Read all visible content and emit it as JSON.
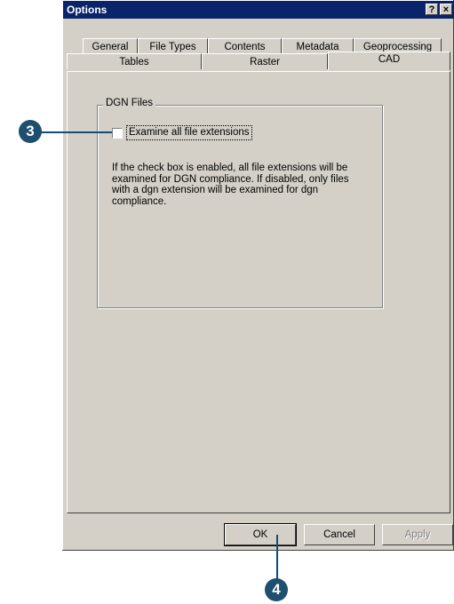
{
  "window": {
    "title": "Options",
    "help_button": "?",
    "close_button": "×"
  },
  "tabs": {
    "row1": [
      "General",
      "File Types",
      "Contents",
      "Metadata",
      "Geoprocessing"
    ],
    "row2": [
      "Tables",
      "Raster",
      "CAD"
    ],
    "active": "CAD"
  },
  "dgn": {
    "group_title": "DGN Files",
    "checkbox_label": "Examine all file extensions",
    "checkbox_checked": false,
    "description": "If the check box is enabled, all file extensions will be examined for DGN compliance.  If disabled, only files with a dgn extension will be examined for dgn compliance."
  },
  "buttons": {
    "ok": "OK",
    "cancel": "Cancel",
    "apply": "Apply",
    "apply_enabled": false
  },
  "callouts": {
    "step3": "3",
    "step4": "4",
    "color": "#1f4f6e"
  }
}
